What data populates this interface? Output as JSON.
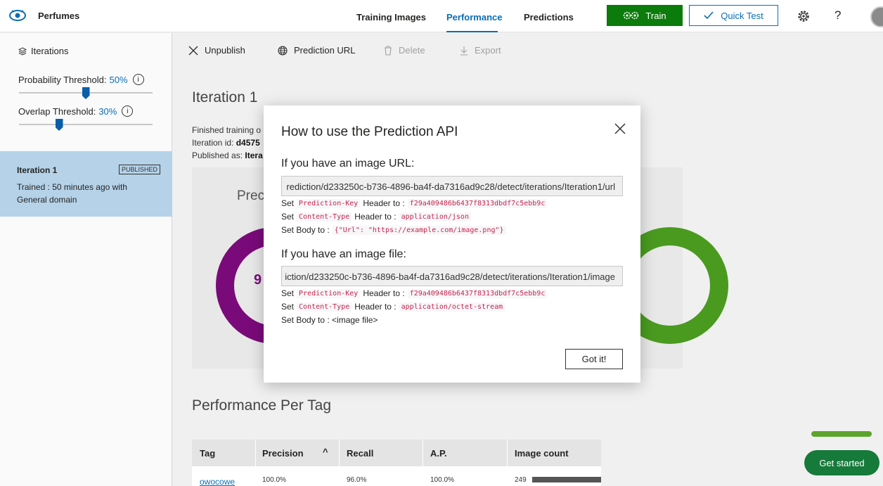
{
  "app": {
    "name": "Perfumes"
  },
  "nav": {
    "tabs": [
      {
        "label": "Training Images"
      },
      {
        "label": "Performance"
      },
      {
        "label": "Predictions"
      }
    ],
    "train_label": "Train",
    "quick_test_label": "Quick Test",
    "help_label": "?"
  },
  "sidebar": {
    "iterations_label": "Iterations",
    "probability": {
      "label": "Probability Threshold:",
      "value": "50%",
      "fraction": 0.5
    },
    "overlap": {
      "label": "Overlap Threshold:",
      "value": "30%",
      "fraction": 0.3
    },
    "iteration_card": {
      "name": "Iteration 1",
      "badge": "PUBLISHED",
      "description": "Trained : 50 minutes ago with General domain"
    }
  },
  "toolbar": {
    "unpublish": "Unpublish",
    "prediction_url": "Prediction URL",
    "delete": "Delete",
    "export": "Export"
  },
  "main": {
    "iteration_title": "Iteration 1",
    "finished_training": "Finished training o",
    "iteration_id_label": "Iteration id:",
    "iteration_id_value": "d4575",
    "published_as_label": "Published as:",
    "published_as_value": "Itera",
    "precision_label": "Prec",
    "precision_value": "9",
    "perf_per_tag_title": "Performance Per Tag"
  },
  "table": {
    "columns": [
      "Tag",
      "Precision",
      "Recall",
      "A.P.",
      "Image count"
    ],
    "sort_indicator": "^",
    "rows": [
      {
        "tag": "owocowe",
        "precision": "100.0%",
        "recall": "96.0%",
        "ap": "100.0%",
        "image_count": "249"
      }
    ]
  },
  "get_started": {
    "label": "Get started"
  },
  "modal": {
    "title": "How to use the Prediction API",
    "url_section": {
      "heading": "If you have an image URL:",
      "endpoint": "rediction/d233250c-b736-4896-ba4f-da7316ad9c28/detect/iterations/Iteration1/url",
      "lines": [
        {
          "prefix": "Set",
          "key": "Prediction-Key",
          "mid": "Header to :",
          "value": "f29a409486b6437f8313dbdf7c5ebb9c"
        },
        {
          "prefix": "Set",
          "key": "Content-Type",
          "mid": "Header to :",
          "value": "application/json"
        }
      ],
      "body_prefix": "Set Body to :",
      "body_value": "{\"Url\": \"https://example.com/image.png\"}"
    },
    "file_section": {
      "heading": "If you have an image file:",
      "endpoint": "iction/d233250c-b736-4896-ba4f-da7316ad9c28/detect/iterations/Iteration1/image",
      "lines": [
        {
          "prefix": "Set",
          "key": "Prediction-Key",
          "mid": "Header to :",
          "value": "f29a409486b6437f8313dbdf7c5ebb9c"
        },
        {
          "prefix": "Set",
          "key": "Content-Type",
          "mid": "Header to :",
          "value": "application/octet-stream"
        }
      ],
      "body_text": "Set Body to : <image file>"
    },
    "ok_label": "Got it!"
  },
  "colors": {
    "accent": "#0a6eb4",
    "train_green": "#0b7b0b",
    "donut_purple": "#7a0a7a",
    "donut_green": "#4a9a20",
    "code_red": "#c7254e"
  }
}
